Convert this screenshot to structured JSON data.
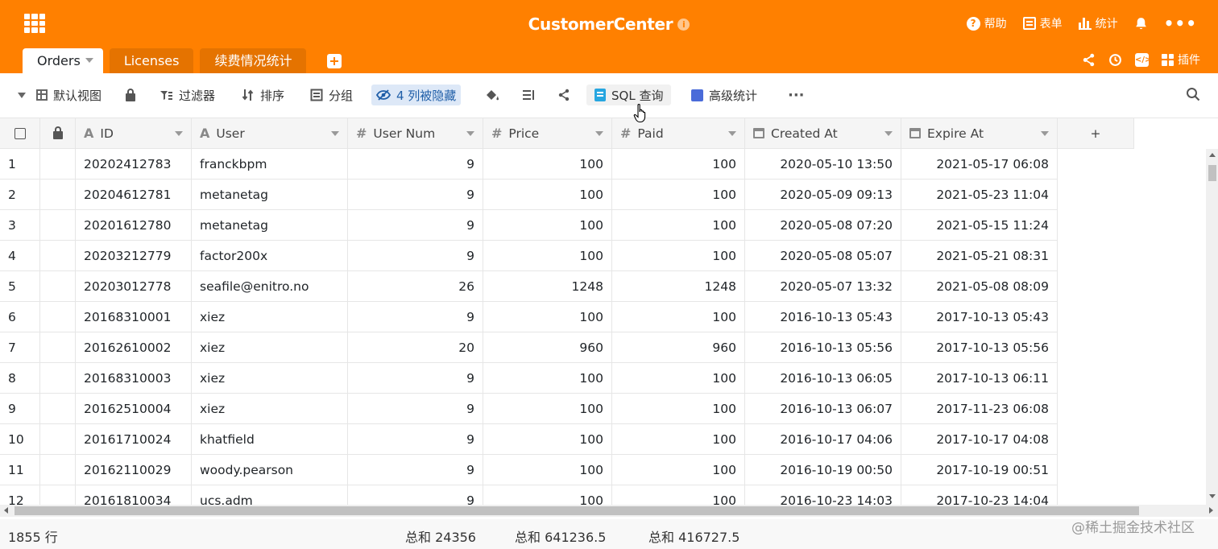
{
  "header": {
    "title": "CustomerCenter",
    "help_label": "帮助",
    "form_label": "表单",
    "stats_label": "统计",
    "plugins_label": "插件",
    "brand_color": "#ff8000"
  },
  "tabs": [
    {
      "label": "Orders",
      "active": true
    },
    {
      "label": "Licenses",
      "active": false
    },
    {
      "label": "续费情况统计",
      "active": false
    }
  ],
  "toolbar": {
    "view_label": "默认视图",
    "filter_label": "过滤器",
    "sort_label": "排序",
    "group_label": "分组",
    "hidden_label": "4 列被隐藏",
    "sql_label": "SQL 查询",
    "advanced_stats_label": "高级统计"
  },
  "columns": [
    {
      "label": "ID",
      "type": "text"
    },
    {
      "label": "User",
      "type": "text"
    },
    {
      "label": "User Num",
      "type": "number"
    },
    {
      "label": "Price",
      "type": "number"
    },
    {
      "label": "Paid",
      "type": "number"
    },
    {
      "label": "Created At",
      "type": "date"
    },
    {
      "label": "Expire At",
      "type": "date"
    }
  ],
  "rows": [
    [
      "1",
      "20202412783",
      "franckbpm",
      "9",
      "100",
      "100",
      "2020-05-10 13:50",
      "2021-05-17 06:08"
    ],
    [
      "2",
      "20204612781",
      "metanetag",
      "9",
      "100",
      "100",
      "2020-05-09 09:13",
      "2021-05-23 11:04"
    ],
    [
      "3",
      "20201612780",
      "metanetag",
      "9",
      "100",
      "100",
      "2020-05-08 07:20",
      "2021-05-15 11:24"
    ],
    [
      "4",
      "20203212779",
      "factor200x",
      "9",
      "100",
      "100",
      "2020-05-08 05:07",
      "2021-05-21 08:31"
    ],
    [
      "5",
      "20203012778",
      "seafile@enitro.no",
      "26",
      "1248",
      "1248",
      "2020-05-07 13:32",
      "2021-05-08 08:09"
    ],
    [
      "6",
      "20168310001",
      "xiez",
      "9",
      "100",
      "100",
      "2016-10-13 05:43",
      "2017-10-13 05:43"
    ],
    [
      "7",
      "20162610002",
      "xiez",
      "20",
      "960",
      "960",
      "2016-10-13 05:56",
      "2017-10-13 05:56"
    ],
    [
      "8",
      "20168310003",
      "xiez",
      "9",
      "100",
      "100",
      "2016-10-13 06:05",
      "2017-10-13 06:11"
    ],
    [
      "9",
      "20162510004",
      "xiez",
      "9",
      "100",
      "100",
      "2016-10-13 06:07",
      "2017-11-23 06:08"
    ],
    [
      "10",
      "20161710024",
      "khatfield",
      "9",
      "100",
      "100",
      "2016-10-17 04:06",
      "2017-10-17 04:08"
    ],
    [
      "11",
      "20162110029",
      "woody.pearson",
      "9",
      "100",
      "100",
      "2016-10-19 00:50",
      "2017-10-19 00:51"
    ],
    [
      "12",
      "20161810034",
      "ucs.adm",
      "9",
      "100",
      "100",
      "2016-10-23 14:03",
      "2017-10-23 14:04"
    ]
  ],
  "footer": {
    "row_count": "1855 行",
    "sum_user_num": "总和 24356",
    "sum_price": "总和 641236.5",
    "sum_paid": "总和 416727.5",
    "watermark": "@稀土掘金技术社区"
  }
}
